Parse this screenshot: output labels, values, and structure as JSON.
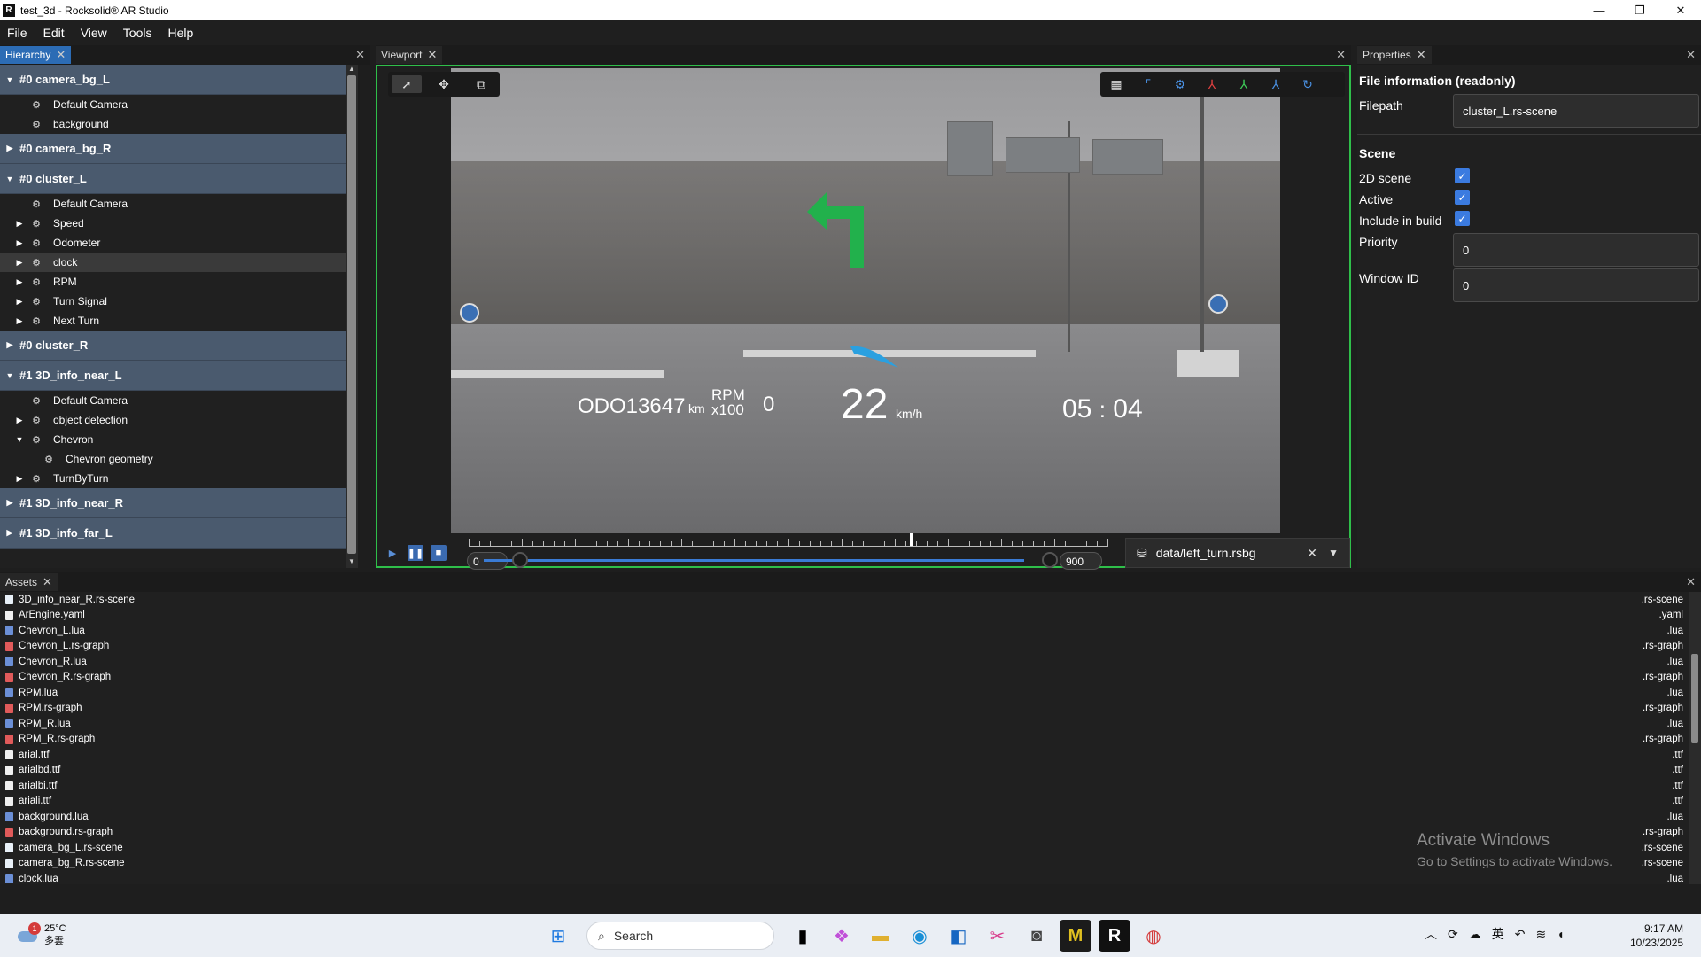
{
  "window": {
    "title": "test_3d - Rocksolid® AR Studio",
    "logo": "R"
  },
  "menu": [
    "File",
    "Edit",
    "View",
    "Tools",
    "Help"
  ],
  "hierarchy": {
    "tab": "Hierarchy",
    "groups": [
      {
        "label": "#0 camera_bg_L",
        "open": true,
        "items": [
          {
            "label": "Default Camera",
            "arrow": ""
          },
          {
            "label": "background",
            "arrow": ""
          }
        ]
      },
      {
        "label": "#0 camera_bg_R",
        "open": false,
        "items": []
      },
      {
        "label": "#0 cluster_L",
        "open": true,
        "items": [
          {
            "label": "Default Camera",
            "arrow": ""
          },
          {
            "label": "Speed",
            "arrow": "▶"
          },
          {
            "label": "Odometer",
            "arrow": "▶"
          },
          {
            "label": "clock",
            "arrow": "▶",
            "selected": true
          },
          {
            "label": "RPM",
            "arrow": "▶"
          },
          {
            "label": "Turn Signal",
            "arrow": "▶"
          },
          {
            "label": "Next Turn",
            "arrow": "▶"
          }
        ]
      },
      {
        "label": "#0 cluster_R",
        "open": false,
        "items": []
      },
      {
        "label": "#1 3D_info_near_L",
        "open": true,
        "items": [
          {
            "label": "Default Camera",
            "arrow": ""
          },
          {
            "label": "object detection",
            "arrow": "▶"
          },
          {
            "label": "Chevron",
            "arrow": "▼"
          },
          {
            "label": "Chevron geometry",
            "arrow": "",
            "indent": true
          },
          {
            "label": "TurnByTurn",
            "arrow": "▶"
          }
        ]
      },
      {
        "label": "#1 3D_info_near_R",
        "open": false,
        "items": []
      },
      {
        "label": "#1 3D_info_far_L",
        "open": false,
        "items": []
      }
    ]
  },
  "viewport": {
    "tab": "Viewport",
    "hud": {
      "odo_label": "ODO",
      "odo_value": "13647",
      "odo_unit": "km",
      "rpm_label": "RPM",
      "rpm_scale": "x100",
      "rpm_value": "0",
      "speed": "22",
      "speed_unit": "km/h",
      "clock_h": "05",
      "clock_sep": ":",
      "clock_m": "04"
    },
    "timeline": {
      "start": "0",
      "end": "900",
      "position": 0.69
    },
    "file": "data/left_turn.rsbg"
  },
  "properties": {
    "tab": "Properties",
    "file_info_title": "File information (readonly)",
    "filepath_label": "Filepath",
    "filepath_value": "cluster_L.rs-scene",
    "scene_title": "Scene",
    "scene_2d_label": "2D scene",
    "active_label": "Active",
    "include_label": "Include in build",
    "priority_label": "Priority",
    "priority_value": "0",
    "window_id_label": "Window ID",
    "window_id_value": "0",
    "check_mark": "✓"
  },
  "assets": {
    "tab": "Assets",
    "files": [
      {
        "name": "3D_info_near_R.rs-scene",
        "ext": ".rs-scene",
        "color": "#e8f0f8"
      },
      {
        "name": "ArEngine.yaml",
        "ext": ".yaml",
        "color": "#f0f0f0"
      },
      {
        "name": "Chevron_L.lua",
        "ext": ".lua",
        "color": "#6b8fd6"
      },
      {
        "name": "Chevron_L.rs-graph",
        "ext": ".rs-graph",
        "color": "#e05a5a"
      },
      {
        "name": "Chevron_R.lua",
        "ext": ".lua",
        "color": "#6b8fd6"
      },
      {
        "name": "Chevron_R.rs-graph",
        "ext": ".rs-graph",
        "color": "#e05a5a"
      },
      {
        "name": "RPM.lua",
        "ext": ".lua",
        "color": "#6b8fd6"
      },
      {
        "name": "RPM.rs-graph",
        "ext": ".rs-graph",
        "color": "#e05a5a"
      },
      {
        "name": "RPM_R.lua",
        "ext": ".lua",
        "color": "#6b8fd6"
      },
      {
        "name": "RPM_R.rs-graph",
        "ext": ".rs-graph",
        "color": "#e05a5a"
      },
      {
        "name": "arial.ttf",
        "ext": ".ttf",
        "color": "#f0f0f0"
      },
      {
        "name": "arialbd.ttf",
        "ext": ".ttf",
        "color": "#f0f0f0"
      },
      {
        "name": "arialbi.ttf",
        "ext": ".ttf",
        "color": "#f0f0f0"
      },
      {
        "name": "ariali.ttf",
        "ext": ".ttf",
        "color": "#f0f0f0"
      },
      {
        "name": "background.lua",
        "ext": ".lua",
        "color": "#6b8fd6"
      },
      {
        "name": "background.rs-graph",
        "ext": ".rs-graph",
        "color": "#e05a5a"
      },
      {
        "name": "camera_bg_L.rs-scene",
        "ext": ".rs-scene",
        "color": "#e8f0f8"
      },
      {
        "name": "camera_bg_R.rs-scene",
        "ext": ".rs-scene",
        "color": "#e8f0f8"
      },
      {
        "name": "clock.lua",
        "ext": ".lua",
        "color": "#6b8fd6"
      }
    ]
  },
  "watermark": {
    "line1": "Activate Windows",
    "line2": "Go to Settings to activate Windows."
  },
  "taskbar": {
    "temp": "25°C",
    "weather_desc": "多雲",
    "badge": "1",
    "search_placeholder": "Search",
    "time": "9:17 AM",
    "date": "10/23/2025",
    "ime": "英"
  }
}
